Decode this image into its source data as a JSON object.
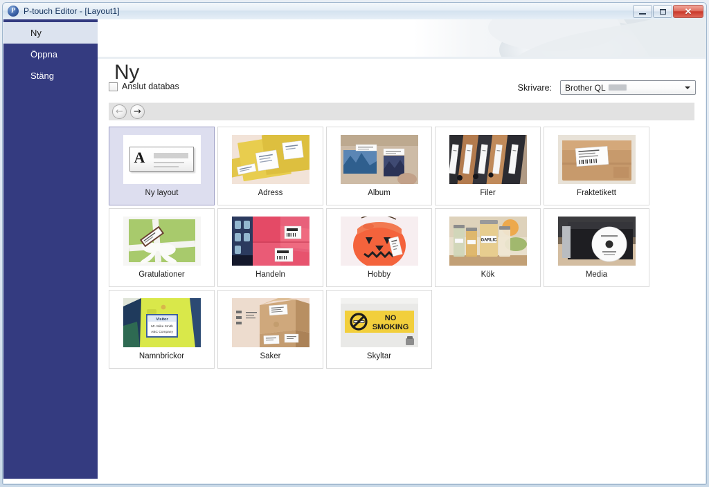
{
  "window": {
    "title": "P-touch Editor - [Layout1]",
    "app_icon": "ptouch-logo-icon",
    "buttons": {
      "minimize": "minimize-icon",
      "maximize": "maximize-icon",
      "close": "✕"
    }
  },
  "sidebar": {
    "items": [
      {
        "label": "Ny",
        "selected": true
      },
      {
        "label": "Öppna",
        "selected": false
      },
      {
        "label": "Stäng",
        "selected": false
      }
    ]
  },
  "main": {
    "page_title": "Ny",
    "database_checkbox": {
      "label": "Anslut databas",
      "checked": false
    },
    "printer": {
      "label": "Skrivare:",
      "value": "Brother QL",
      "value_redacted": true
    },
    "navigation": {
      "back": {
        "icon": "arrow-left-icon",
        "glyph": "←",
        "enabled": false
      },
      "forward": {
        "icon": "arrow-right-icon",
        "glyph": "→",
        "enabled": true
      }
    },
    "templates": [
      {
        "label": "Ny layout",
        "selected": true,
        "thumb": "new-layout-document"
      },
      {
        "label": "Adress",
        "selected": false,
        "thumb": "yellow-envelopes-with-address-labels"
      },
      {
        "label": "Album",
        "selected": false,
        "thumb": "scrapbook-photos-with-labels"
      },
      {
        "label": "Filer",
        "selected": false,
        "thumb": "binders-with-spine-labels"
      },
      {
        "label": "Fraktetikett",
        "selected": false,
        "thumb": "parcel-with-shipping-label"
      },
      {
        "label": "Gratulationer",
        "selected": false,
        "thumb": "green-gift-box-with-ribbon-and-tag"
      },
      {
        "label": "Handeln",
        "selected": false,
        "thumb": "red-retail-boxes-with-barcode-labels"
      },
      {
        "label": "Hobby",
        "selected": false,
        "thumb": "orange-halloween-pumpkin-with-label"
      },
      {
        "label": "Kök",
        "selected": false,
        "thumb": "spice-jars-with-garlic-label"
      },
      {
        "label": "Media",
        "selected": false,
        "thumb": "disc-case-with-cd-label"
      },
      {
        "label": "Namnbrickor",
        "selected": false,
        "thumb": "visitor-name-badge"
      },
      {
        "label": "Saker",
        "selected": false,
        "thumb": "cardboard-storage-boxes-with-labels"
      },
      {
        "label": "Skyltar",
        "selected": false,
        "thumb": "yellow-no-smoking-sign"
      }
    ],
    "thumb_text": {
      "kok_jar_label": "GARLIC",
      "skyltar_line1": "NO",
      "skyltar_line2": "SMOKING",
      "badge_title": "Visitor",
      "badge_name": "Mr. Mike Smith",
      "badge_company": "ABC Company",
      "new_layout_letter": "A"
    }
  },
  "colors": {
    "sidebar_bg": "#343b80",
    "sidebar_selected_bg": "#dce3ef",
    "tile_selected_bg": "#dddeef",
    "tile_selected_border": "#9b9cc4",
    "toolbar_bg": "#e2e2e2",
    "close_button": "#c9392b",
    "title_text": "#15335c"
  }
}
